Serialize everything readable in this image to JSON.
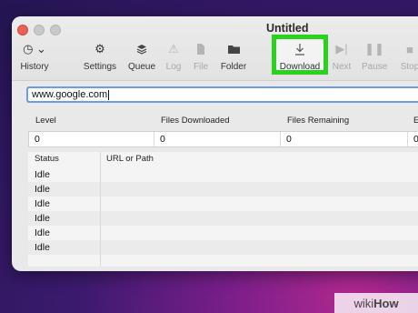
{
  "window": {
    "title": "Untitled"
  },
  "toolbar": {
    "history": "History",
    "settings": "Settings",
    "queue": "Queue",
    "log": "Log",
    "file": "File",
    "folder": "Folder",
    "download": "Download",
    "next": "Next",
    "pause": "Pause",
    "stop": "Stop"
  },
  "url_field": {
    "value": "www.google.com"
  },
  "stats": {
    "headers": [
      "Level",
      "Files Downloaded",
      "Files Remaining",
      "E"
    ],
    "values": [
      "0",
      "0",
      "0",
      "0"
    ]
  },
  "table": {
    "headers": [
      "Status",
      "URL or Path"
    ],
    "rows": [
      {
        "status": "Idle"
      },
      {
        "status": "Idle"
      },
      {
        "status": "Idle"
      },
      {
        "status": "Idle"
      },
      {
        "status": "Idle"
      },
      {
        "status": "Idle"
      }
    ]
  },
  "watermark": {
    "brand_a": "wiki",
    "brand_b": "How"
  },
  "colors": {
    "highlight": "#2bd21d",
    "focus_ring": "#6b9bea"
  }
}
